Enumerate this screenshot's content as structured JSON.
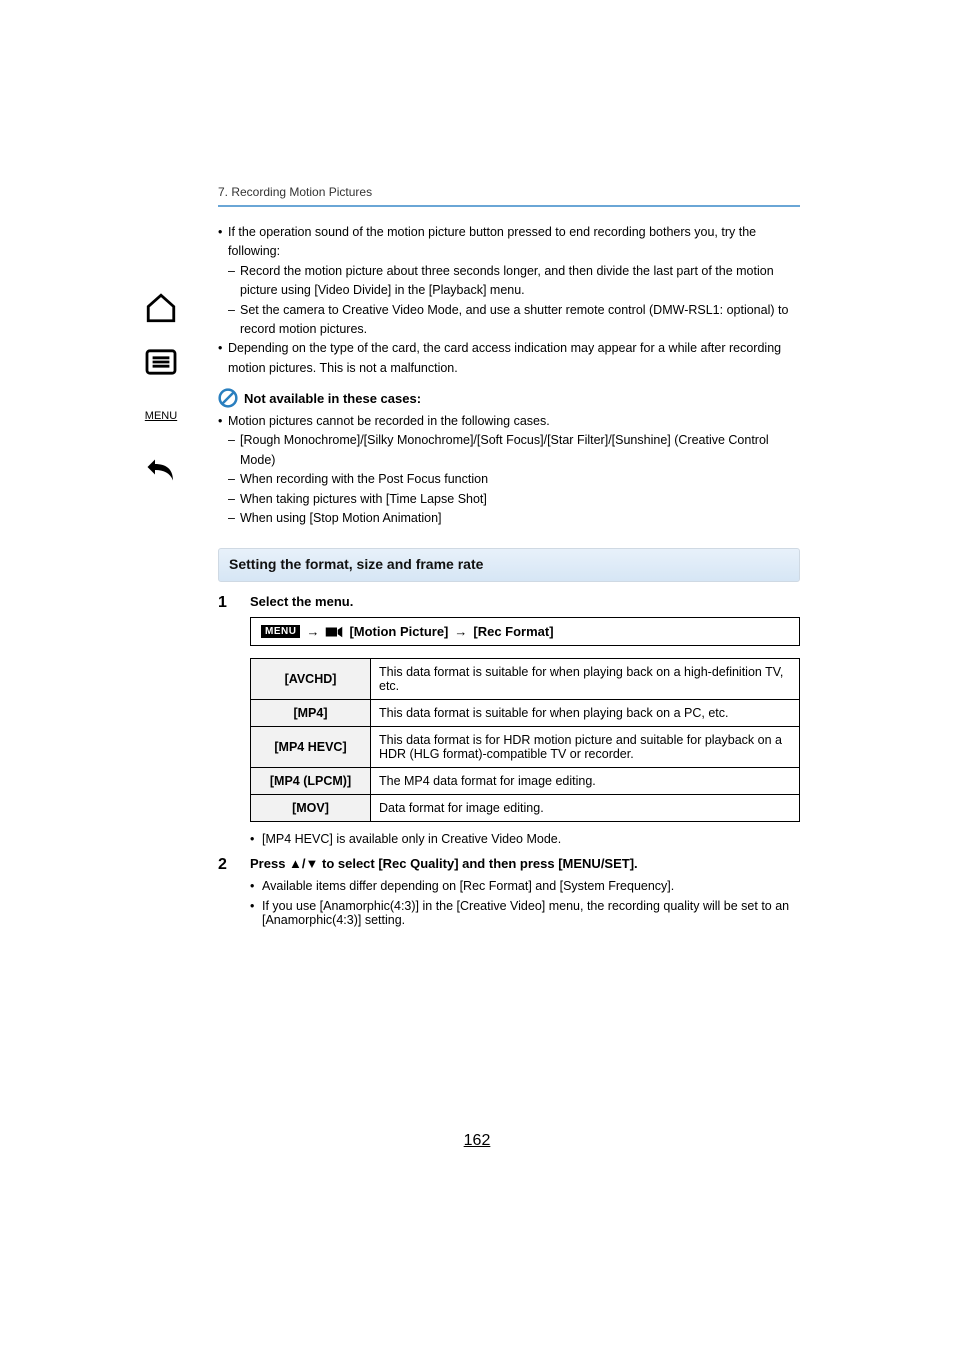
{
  "chapter": "7. Recording Motion Pictures",
  "body": {
    "b1": "If the operation sound of the motion picture button pressed to end recording bothers you, try the following:",
    "b1a": "Record the motion picture about three seconds longer, and then divide the last part of the motion picture using [Video Divide] in the [Playback] menu.",
    "b1b": "Set the camera to Creative Video Mode, and use a shutter remote control (DMW-RSL1: optional) to record motion pictures.",
    "b2": "Depending on the type of the card, the card access indication may appear for a while after recording motion pictures. This is not a malfunction.",
    "not_avail_title": "Not available in these cases:",
    "na1": "Motion pictures cannot be recorded in the following cases.",
    "na1a": "[Rough Monochrome]/[Silky Monochrome]/[Soft Focus]/[Star Filter]/[Sunshine] (Creative Control Mode)",
    "na1b": "When recording with the Post Focus function",
    "na1c": "When taking pictures with [Time Lapse Shot]",
    "na1d": "When using [Stop Motion Animation]"
  },
  "section_title": "Setting the format, size and frame rate",
  "step1": {
    "num": "1",
    "title": "Select the menu.",
    "menu_label": "MENU",
    "path1": "[Motion Picture]",
    "path2": "[Rec Format]",
    "table": {
      "r1_label": "[AVCHD]",
      "r1_desc": "This data format is suitable for when playing back on a high-definition TV, etc.",
      "r2_label": "[MP4]",
      "r2_desc": "This data format is suitable for when playing back on a PC, etc.",
      "r3_label": "[MP4 HEVC]",
      "r3_desc": "This data format is for HDR motion picture and suitable for playback on a HDR (HLG format)-compatible TV or recorder.",
      "r4_label": "[MP4 (LPCM)]",
      "r4_desc": "The MP4 data format for image editing.",
      "r5_label": "[MOV]",
      "r5_desc": "Data format for image editing."
    },
    "note": "[MP4 HEVC] is available only in Creative Video Mode."
  },
  "step2": {
    "num": "2",
    "title": "Press ▲/▼ to select [Rec Quality] and then press [MENU/SET].",
    "n1": "Available items differ depending on [Rec Format] and [System Frequency].",
    "n2": "If you use [Anamorphic(4:3)] in the [Creative Video] menu, the recording quality will be set to an [Anamorphic(4:3)] setting."
  },
  "page_number": "162"
}
